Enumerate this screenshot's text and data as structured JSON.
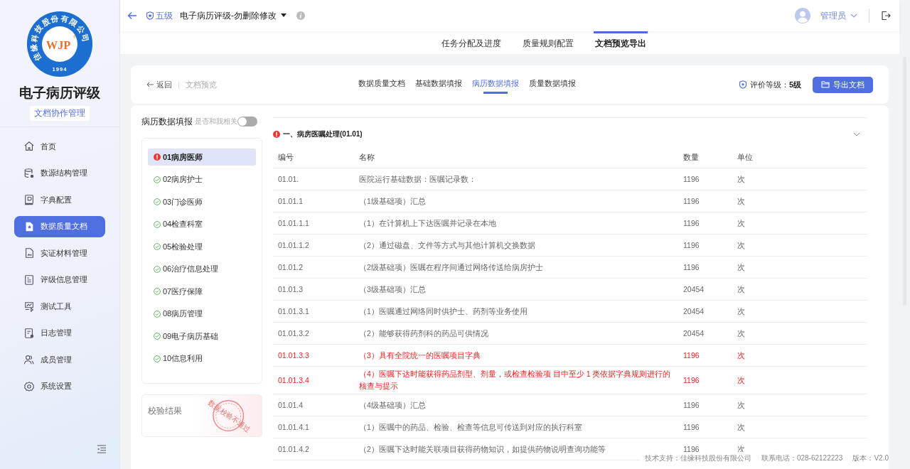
{
  "logo": {
    "ring_text": "佳缘科技股份有限公司",
    "mark": "WJP",
    "registered": "®",
    "year": "1994"
  },
  "app": {
    "title": "电子病历评级",
    "subtitle": "文档协作管理"
  },
  "sidebar": {
    "items": [
      {
        "label": "首页",
        "selected": false
      },
      {
        "label": "数源结构管理",
        "selected": false
      },
      {
        "label": "字典配置",
        "selected": false
      },
      {
        "label": "数据质量文档",
        "selected": true
      },
      {
        "label": "实证材料管理",
        "selected": false
      },
      {
        "label": "评级信息管理",
        "selected": false
      },
      {
        "label": "测试工具",
        "selected": false
      },
      {
        "label": "日志管理",
        "selected": false
      },
      {
        "label": "成员管理",
        "selected": false
      },
      {
        "label": "系统设置",
        "selected": false
      }
    ]
  },
  "header": {
    "level_badge": "五级",
    "project": "电子病历评级-勿删除修改",
    "user": "管理员"
  },
  "top_tabs": [
    {
      "label": "任务分配及进度",
      "selected": false
    },
    {
      "label": "质量规则配置",
      "selected": false
    },
    {
      "label": "文档预览导出",
      "selected": true
    }
  ],
  "toolbar": {
    "back": "返回",
    "breadcrumb": "文档预览",
    "tabs": [
      {
        "label": "数据质量文档",
        "selected": false
      },
      {
        "label": "基础数据填报",
        "selected": false
      },
      {
        "label": "病历数据填报",
        "selected": true
      },
      {
        "label": "质量数据填报",
        "selected": false
      }
    ],
    "grade_label": "评价等级：",
    "grade_value": "5级",
    "export_button": "导出文档"
  },
  "panel": {
    "title": "病历数据填报",
    "toggle_label": "是否和我相关",
    "toggle_on": false,
    "roles": [
      {
        "label": "01病房医师",
        "error": true,
        "selected": true
      },
      {
        "label": "02病房护士",
        "error": false,
        "selected": false
      },
      {
        "label": "03门诊医师",
        "error": false,
        "selected": false
      },
      {
        "label": "04检查科室",
        "error": false,
        "selected": false
      },
      {
        "label": "05检验处理",
        "error": false,
        "selected": false
      },
      {
        "label": "06治疗信息处理",
        "error": false,
        "selected": false
      },
      {
        "label": "07医疗保障",
        "error": false,
        "selected": false
      },
      {
        "label": "08病历管理",
        "error": false,
        "selected": false
      },
      {
        "label": "09电子病历基础",
        "error": false,
        "selected": false
      },
      {
        "label": "10信息利用",
        "error": false,
        "selected": false
      }
    ],
    "validation": {
      "title": "校验结果",
      "stamp": "数据校验不通过"
    }
  },
  "section": {
    "title": "一、病房医嘱处理(01.01)",
    "error": true,
    "expanded": true,
    "columns": [
      "编号",
      "名称",
      "数量",
      "单位"
    ],
    "rows": [
      {
        "cells": [
          "01.01.",
          "医院运行基础数据：医嘱记录数：",
          "1196",
          "次"
        ],
        "error": false
      },
      {
        "cells": [
          "01.01.1",
          "（1级基础项）汇总",
          "1196",
          "次"
        ],
        "error": false
      },
      {
        "cells": [
          "01.01.1.1",
          "（1）在计算机上下达医嘱并记录在本地",
          "1196",
          "次"
        ],
        "error": false
      },
      {
        "cells": [
          "01.01.1.2",
          "（2）通过磁盘、文件等方式与其他计算机交换数据",
          "1196",
          "次"
        ],
        "error": false
      },
      {
        "cells": [
          "01.01.2",
          "（2级基础项）医嘱在程序间通过网络传送给病房护士",
          "1196",
          "次"
        ],
        "error": false
      },
      {
        "cells": [
          "01.01.3",
          "（3级基础项）汇总",
          "20454",
          "次"
        ],
        "error": false
      },
      {
        "cells": [
          "01.01.3.1",
          "（1）医嘱通过网络同时供护士、药剂等业务使用",
          "20454",
          "次"
        ],
        "error": false
      },
      {
        "cells": [
          "01.01.3.2",
          "（2）能够获得药剂科的药品可供情况",
          "20454",
          "次"
        ],
        "error": false
      },
      {
        "cells": [
          "01.01.3.3",
          "（3）具有全院统一的医嘱项目字典",
          "1196",
          "次"
        ],
        "error": true
      },
      {
        "cells": [
          "01.01.3.4",
          "（4）医嘱下达时能获得药品剂型、剂量，或检查检验项 目中至少 1 类依据字典规则进行的核查与提示",
          "1196",
          "次"
        ],
        "error": true
      },
      {
        "cells": [
          "01.01.4",
          "（4级基础项）汇总",
          "1196",
          "次"
        ],
        "error": false
      },
      {
        "cells": [
          "01.01.4.1",
          "（1）医嘱中的药品、检验、检查等信息可传送到对应的执行科室",
          "1196",
          "次"
        ],
        "error": false
      },
      {
        "cells": [
          "01.01.4.2",
          "（2）医嘱下达时能关联项目获得药物知识，如提供药物说明查询功能等",
          "1196",
          "次"
        ],
        "error": false
      }
    ]
  },
  "footer": {
    "support": "技术支持：佳缘科技股份有限公司",
    "phone": "联系电话：028-62122223",
    "version": "版本：V2.0"
  }
}
